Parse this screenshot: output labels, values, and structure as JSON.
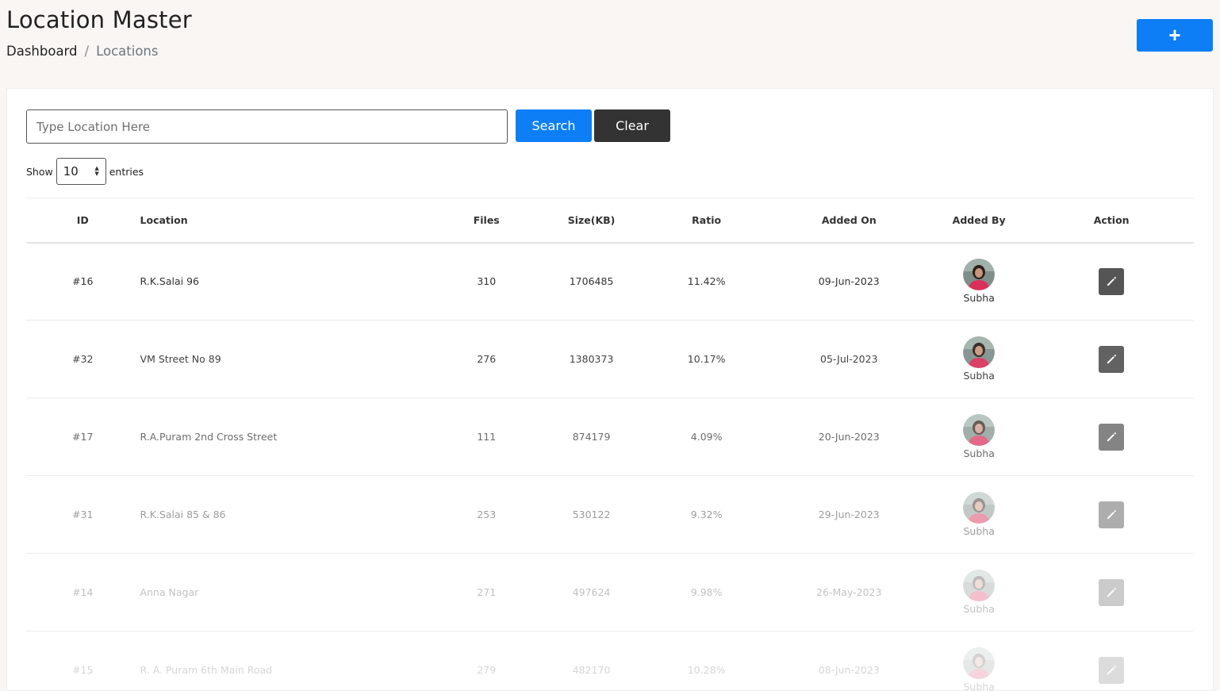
{
  "header": {
    "title": "Location Master",
    "breadcrumb": {
      "home": "Dashboard",
      "separator": "/",
      "current": "Locations"
    },
    "add_button_label": "+"
  },
  "search": {
    "placeholder": "Type Location Here",
    "value": "",
    "search_label": "Search",
    "clear_label": "Clear"
  },
  "entries": {
    "show_label": "Show",
    "selected": "10",
    "entries_label": "entries"
  },
  "table": {
    "columns": [
      "ID",
      "Location",
      "Files",
      "Size(KB)",
      "Ratio",
      "Added On",
      "Added By",
      "Action"
    ],
    "rows": [
      {
        "id": "#16",
        "location": "R.K.Salai 96",
        "files": "310",
        "size": "1706485",
        "ratio": "11.42%",
        "added_on": "09-Jun-2023",
        "added_by": "Subha"
      },
      {
        "id": "#32",
        "location": "VM Street No 89",
        "files": "276",
        "size": "1380373",
        "ratio": "10.17%",
        "added_on": "05-Jul-2023",
        "added_by": "Subha"
      },
      {
        "id": "#17",
        "location": "R.A.Puram 2nd Cross Street",
        "files": "111",
        "size": "874179",
        "ratio": "4.09%",
        "added_on": "20-Jun-2023",
        "added_by": "Subha"
      },
      {
        "id": "#31",
        "location": "R.K.Salai 85 & 86",
        "files": "253",
        "size": "530122",
        "ratio": "9.32%",
        "added_on": "29-Jun-2023",
        "added_by": "Subha"
      },
      {
        "id": "#14",
        "location": "Anna Nagar",
        "files": "271",
        "size": "497624",
        "ratio": "9.98%",
        "added_on": "26-May-2023",
        "added_by": "Subha"
      },
      {
        "id": "#15",
        "location": "R. A. Puram 6th Main Road",
        "files": "279",
        "size": "482170",
        "ratio": "10.28%",
        "added_on": "08-Jun-2023",
        "added_by": "Subha"
      }
    ]
  },
  "colors": {
    "primary": "#0d7ef6",
    "dark": "#333333",
    "edit_button": "#555555",
    "page_background": "#f9f6f4"
  },
  "icons": {
    "add": "plus-icon",
    "edit": "pencil-icon",
    "select": "chevron-up-down-icon",
    "avatar": "user-avatar"
  }
}
